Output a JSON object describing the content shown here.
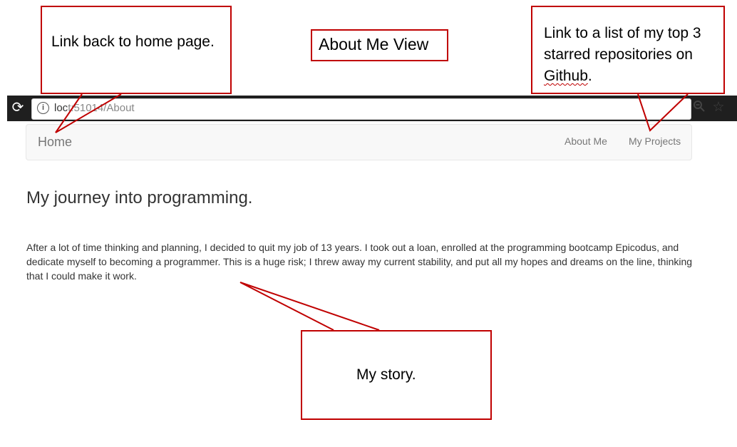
{
  "browser": {
    "url_visible": "loc",
    "url_hidden": "t:51014/About",
    "reload_icon": "reload-icon",
    "info_icon": "info-icon",
    "zoom_icon": "zoom-out-icon",
    "star_icon": "star-icon"
  },
  "navbar": {
    "brand": "Home",
    "links": [
      "About Me",
      "My Projects"
    ]
  },
  "page": {
    "heading": "My journey into programming.",
    "story": "After a lot of time thinking and planning, I decided to quit my job of 13 years. I took out a loan, enrolled at the programming bootcamp Epicodus, and dedicate myself to becoming a programmer. This is a huge risk; I threw away my current stability, and put all my hopes and dreams on the line, thinking that I could make it work."
  },
  "annotations": {
    "home": "Link back to home page.",
    "title": "About Me View",
    "projects_main": "Link to a list of my top 3 starred repositories on ",
    "projects_underlined": "Github",
    "projects_end": ".",
    "story": "My story."
  },
  "colors": {
    "callout_border": "#c00000",
    "browser_bar": "#1f1f1f",
    "navbar_bg": "#f8f8f8"
  }
}
